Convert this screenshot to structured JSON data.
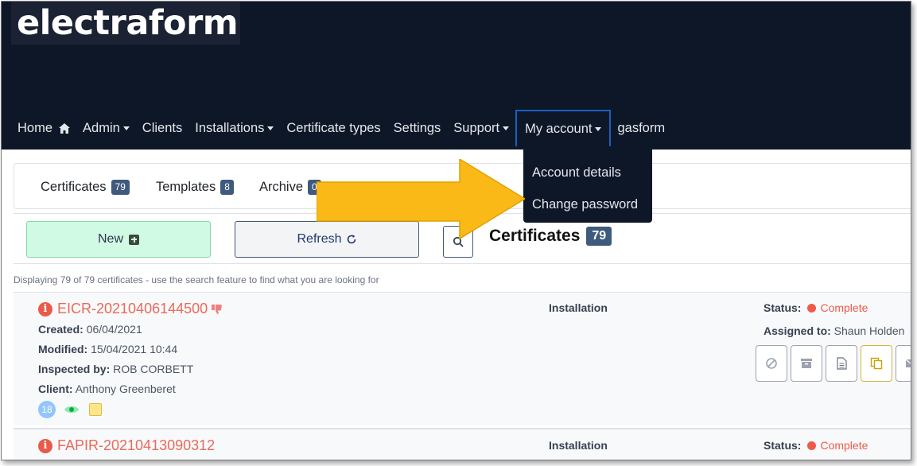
{
  "header": {
    "logo_text": "electraform",
    "nav": {
      "home": "Home",
      "admin": "Admin",
      "clients": "Clients",
      "installations": "Installations",
      "certificate_types": "Certificate types",
      "settings": "Settings",
      "support": "Support",
      "my_account": "My account",
      "gasform": "gasform"
    },
    "account_menu": {
      "account_details": "Account details",
      "change_password": "Change password"
    }
  },
  "tabs": {
    "certificates": {
      "label": "Certificates",
      "count": "79"
    },
    "templates": {
      "label": "Templates",
      "count": "8"
    },
    "archive": {
      "label": "Archive",
      "count": "0"
    }
  },
  "toolbar": {
    "new_label": "New",
    "refresh_label": "Refresh",
    "heading": "Certificates",
    "heading_count": "79"
  },
  "info_line": "Displaying 79 of 79 certificates - use the search feature to find what you are looking for",
  "certificates": [
    {
      "id": "EICR-20210406144500",
      "created_label": "Created:",
      "created": "06/04/2021",
      "modified_label": "Modified:",
      "modified": "15/04/2021 10:44",
      "inspected_label": "Inspected by:",
      "inspected_by": "ROB CORBETT",
      "client_label": "Client:",
      "client": "Anthony Greenberet",
      "installation_label": "Installation",
      "status_label": "Status:",
      "status": "Complete",
      "assigned_label": "Assigned to:",
      "assigned_to": "Shaun Holden",
      "count": "18"
    },
    {
      "id": "FAPIR-20210413090312",
      "installation_label": "Installation",
      "status_label": "Status:",
      "status": "Complete"
    }
  ],
  "colors": {
    "header_bg": "#0e1727",
    "accent_badge": "#3e5a7d",
    "status_complete": "#ef5a4a",
    "cert_link": "#e86a5c",
    "arrow": "#fbb917"
  }
}
